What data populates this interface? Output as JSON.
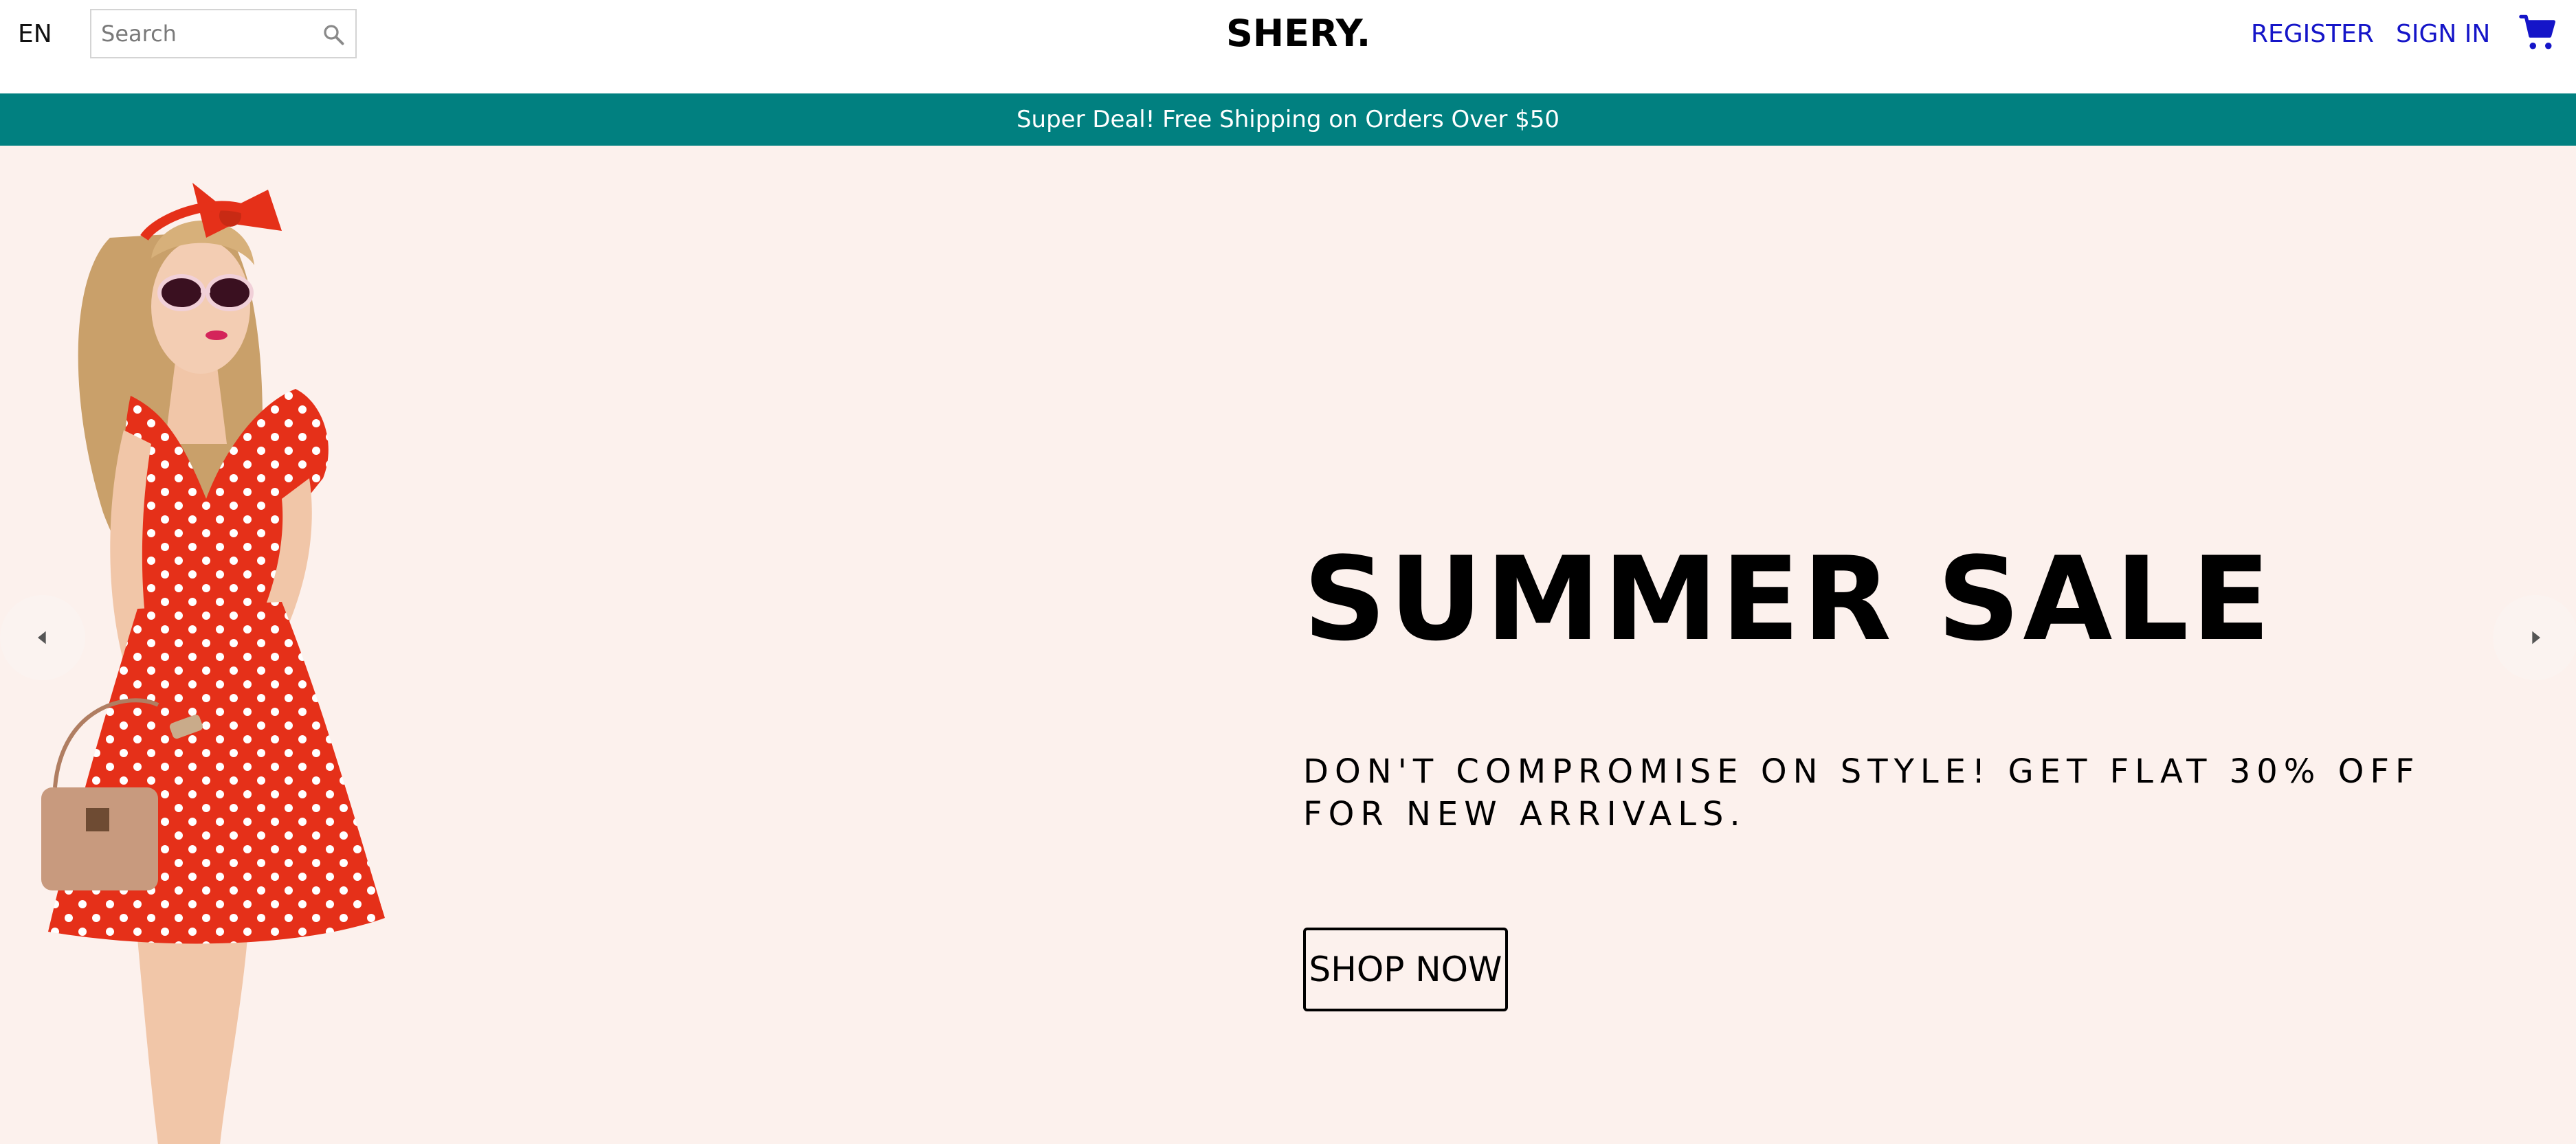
{
  "header": {
    "language": "EN",
    "search_placeholder": "Search",
    "logo": "SHERY.",
    "register_label": "REGISTER",
    "signin_label": "SIGN IN"
  },
  "announcement": {
    "text": "Super Deal! Free Shipping on Orders Over $50"
  },
  "hero": {
    "title": "SUMMER SALE",
    "description": "DON'T COMPROMISE ON STYLE! GET FLAT 30% OFF FOR NEW ARRIVALS.",
    "button_label": "SHOP NOW"
  },
  "colors": {
    "announcement_bg": "#018080",
    "hero_bg": "#fcf1ed",
    "link": "#1515c8",
    "dress": "#e53019"
  },
  "icons": {
    "search": "search-icon",
    "cart": "cart-icon",
    "prev": "arrow-left-icon",
    "next": "arrow-right-icon"
  }
}
